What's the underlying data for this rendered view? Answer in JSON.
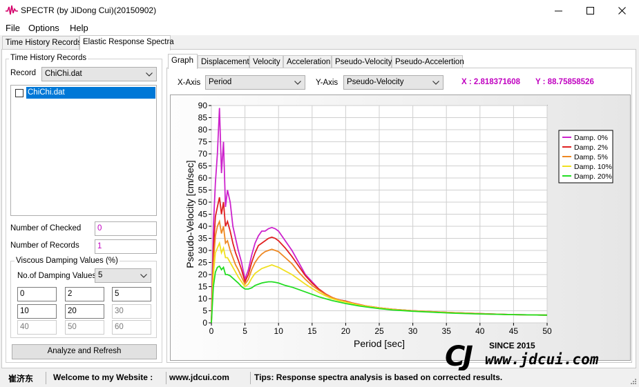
{
  "window": {
    "title": "SPECTR (by JiDong Cui)(20150902)"
  },
  "menu": [
    "File",
    "Options",
    "Help"
  ],
  "outer_tabs": [
    "Time History Records",
    "Elastic Response Spectra"
  ],
  "left": {
    "group_title": "Time History Records",
    "record_label": "Record",
    "record_value": "ChiChi.dat",
    "list_items": [
      "ChiChi.dat"
    ],
    "num_checked_label": "Number of Checked",
    "num_checked_value": "0",
    "num_records_label": "Number of Records",
    "num_records_value": "1",
    "damping_group_title": "Viscous Damping Values (%)",
    "num_damping_label": "No.of Damping Values",
    "num_damping_value": "5",
    "damping_values": [
      "0",
      "2",
      "5",
      "10",
      "20",
      "30",
      "40",
      "50",
      "60"
    ],
    "analyze_button": "Analyze and Refresh"
  },
  "inner_tabs": [
    "Graph",
    "Displacement",
    "Velocity",
    "Acceleration",
    "Pseudo-Velocity",
    "Pseudo-Accelertion"
  ],
  "axis_select": {
    "x_label": "X-Axis",
    "x_value": "Period",
    "y_label": "Y-Axis",
    "y_value": "Pseudo-Velocity",
    "x_readout": "X : 2.818371608",
    "y_readout": "Y : 88.75858526"
  },
  "status": {
    "author": "崔济东",
    "welcome": "Welcome to my Website :",
    "site": "www.jdcui.com",
    "tips": "Tips: Response spectra analysis is based on corrected results."
  },
  "watermark": {
    "since": "SINCE 2015",
    "url": "www.jdcui.com"
  },
  "chart_data": {
    "type": "line",
    "xlabel": "Period [sec]",
    "ylabel": "Pseudo-Velocity [cm/sec]",
    "xlim": [
      0,
      50
    ],
    "ylim": [
      0,
      90
    ],
    "xticks": [
      0,
      5,
      10,
      15,
      20,
      25,
      30,
      35,
      40,
      45,
      50
    ],
    "yticks": [
      0,
      5,
      10,
      15,
      20,
      25,
      30,
      35,
      40,
      45,
      50,
      55,
      60,
      65,
      70,
      75,
      80,
      85,
      90
    ],
    "grid": true,
    "legend_position": "top-right",
    "x": [
      0,
      0.3,
      0.6,
      0.9,
      1.2,
      1.5,
      1.8,
      2.1,
      2.4,
      2.8,
      3.2,
      3.6,
      4,
      4.5,
      5,
      5.5,
      6,
      6.5,
      7,
      7.5,
      8,
      8.5,
      9,
      9.5,
      10,
      11,
      12,
      13,
      14,
      15,
      16,
      17,
      18,
      19,
      20,
      21,
      22,
      23,
      25,
      27,
      30,
      33,
      36,
      40,
      45,
      50
    ],
    "series": [
      {
        "name": "Damp. 0%",
        "color": "#cc22cc",
        "values": [
          0,
          40,
          58,
          70,
          89,
          62,
          75,
          48,
          55,
          50,
          40,
          35,
          30,
          25,
          18,
          22,
          28,
          33,
          36,
          38,
          38,
          39,
          39.5,
          39,
          38,
          34,
          30,
          25,
          20,
          17,
          14,
          12,
          10.5,
          9.5,
          9,
          8.2,
          7.6,
          7,
          6.2,
          5.6,
          5,
          4.6,
          4.2,
          3.8,
          3.4,
          3.2
        ]
      },
      {
        "name": "Damp. 2%",
        "color": "#e02020",
        "values": [
          0,
          30,
          44,
          48,
          52,
          45,
          50,
          40,
          42,
          38,
          33,
          29,
          26,
          22,
          17,
          20,
          25,
          29,
          32,
          33,
          34,
          35,
          35.5,
          35,
          34,
          31,
          27.5,
          23.5,
          19.5,
          16.5,
          14,
          12,
          10.5,
          9.5,
          9,
          8.2,
          7.6,
          7,
          6.2,
          5.6,
          5,
          4.6,
          4.2,
          3.8,
          3.4,
          3.2
        ]
      },
      {
        "name": "Damp. 5%",
        "color": "#ee8822",
        "values": [
          0,
          25,
          36,
          40,
          42,
          37,
          40,
          33,
          34,
          30,
          27,
          24,
          22,
          19,
          16,
          18,
          22,
          25,
          27,
          28.5,
          29.5,
          30,
          30.5,
          30,
          29.5,
          27,
          24.5,
          21,
          18,
          15.5,
          13.5,
          11.8,
          10.5,
          9.5,
          8.8,
          8.1,
          7.5,
          7,
          6.2,
          5.6,
          5,
          4.6,
          4.2,
          3.8,
          3.4,
          3.2
        ]
      },
      {
        "name": "Damp. 10%",
        "color": "#f0e020",
        "values": [
          0,
          20,
          29,
          31,
          33,
          29,
          31,
          27,
          27,
          25,
          23,
          21,
          19,
          17,
          15,
          16,
          18.5,
          20.5,
          21.5,
          22.5,
          23,
          23.5,
          24,
          23.5,
          23,
          21.5,
          20,
          18,
          16,
          14.2,
          12.6,
          11.2,
          10,
          9.2,
          8.6,
          8,
          7.4,
          6.9,
          6.1,
          5.5,
          4.9,
          4.5,
          4.1,
          3.7,
          3.4,
          3.2
        ]
      },
      {
        "name": "Damp. 20%",
        "color": "#22dd22",
        "values": [
          0,
          15,
          21,
          23,
          23.5,
          22,
          23,
          20,
          20,
          19.5,
          18.5,
          17.5,
          16.5,
          15,
          14,
          14,
          14.5,
          15.5,
          16,
          16.5,
          16.8,
          17,
          17,
          16.8,
          16.5,
          15.5,
          14.8,
          13.8,
          12.8,
          11.8,
          10.8,
          10,
          9.2,
          8.6,
          8,
          7.5,
          7,
          6.6,
          5.9,
          5.3,
          4.8,
          4.4,
          4,
          3.7,
          3.4,
          3.2
        ]
      }
    ]
  }
}
